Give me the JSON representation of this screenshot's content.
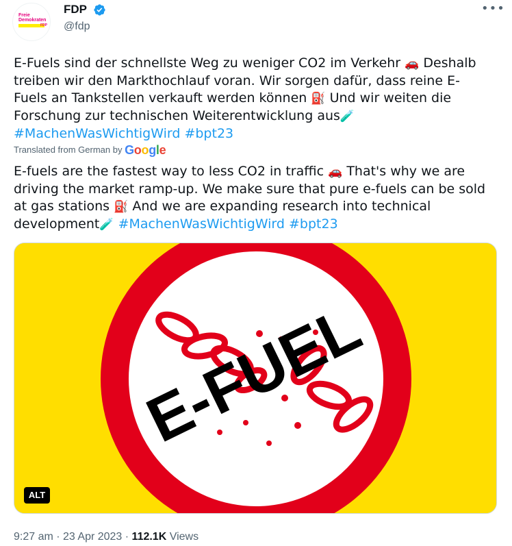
{
  "author": {
    "avatar_line1": "Freie",
    "avatar_line2": "Demokraten",
    "avatar_mini": "FDP",
    "name": "FDP",
    "handle": "@fdp",
    "verified": true,
    "brand_magenta": "#e5007d",
    "brand_yellow": "#ffed00"
  },
  "more_icon": "more-options-icon",
  "tweet": {
    "original": {
      "p1": "E-Fuels sind der schnellste Weg zu weniger CO2 im Verkehr ",
      "e1": "🚗",
      "p2": " Deshalb treiben wir den Markthochlauf voran. Wir sorgen dafür, dass reine E-Fuels an Tankstellen verkauft werden können ",
      "e2": "⛽",
      "p3": " Und wir weiten die Forschung zur technischen Weiterentwicklung aus",
      "e3": "🧪",
      "hashtag1": "#MachenWasWichtigWird",
      "hashtag2": "#bpt23"
    },
    "translated_from": "Translated from German by ",
    "translator": "Google",
    "translation": {
      "p1": "E-fuels are the fastest way to less CO2 in traffic ",
      "e1": "🚗",
      "p2": " That's why we are driving the market ramp-up. We make sure that pure e-fuels can be sold at gas stations ",
      "e2": "⛽",
      "p3": " And we are expanding research into technical development",
      "e3": "🧪",
      "hashtag1": "#MachenWasWichtigWird",
      "hashtag2": "#bpt23"
    }
  },
  "media": {
    "image_text": "E-FUEL",
    "alt_badge": "ALT",
    "colors": {
      "background": "#ffde00",
      "ring": "#e2001a",
      "chain": "#e2001a"
    }
  },
  "meta": {
    "time": "9:27 am",
    "separator": " · ",
    "date": "23 Apr 2023",
    "views_count": "112.1K",
    "views_label": " Views"
  },
  "colors": {
    "link": "#1d9bf0",
    "secondary_text": "#536471",
    "verified": "#1d9bf0"
  }
}
